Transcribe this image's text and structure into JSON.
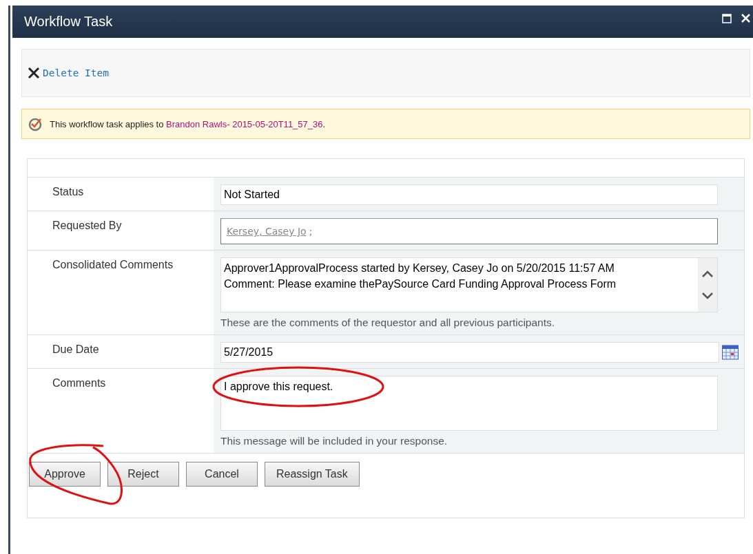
{
  "window": {
    "title": "Workflow Task"
  },
  "toolbar": {
    "actions": [
      {
        "label": "Delete Item"
      }
    ]
  },
  "info_bar": {
    "prefix": "This workflow task applies to ",
    "link": "Brandon Rawls- 2015-05-20T11_57_36",
    "suffix": "."
  },
  "form": {
    "fields": [
      {
        "kind": "text",
        "label": "Status",
        "value": "Not Started"
      },
      {
        "kind": "people",
        "label": "Requested By",
        "value": "Kersey, Casey Jo",
        "separator": ";"
      },
      {
        "kind": "history",
        "label": "Consolidated Comments",
        "lines": [
          "Approver1ApprovalProcess started by Kersey, Casey Jo on 5/20/2015 11:57 AM",
          "Comment: Please examine thePaySource Card Funding Approval Process Form"
        ],
        "hint": "These are the comments of the requestor and all previous participants."
      },
      {
        "kind": "date",
        "label": "Due Date",
        "value": "5/27/2015"
      },
      {
        "kind": "textarea",
        "label": "Comments",
        "value": "I approve this request.",
        "hint": "This message will be included in your response."
      }
    ]
  },
  "buttons": [
    "Approve",
    "Reject",
    "Cancel",
    "Reassign Task"
  ]
}
